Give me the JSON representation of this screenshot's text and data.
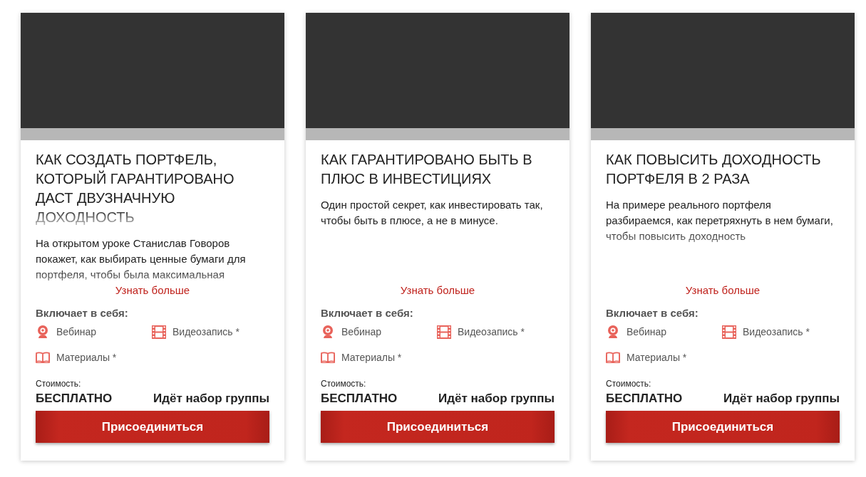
{
  "cards": [
    {
      "title": "КАК СОЗДАТЬ ПОРТФЕЛЬ, КОТОРЫЙ ГАРАНТИРОВАНО ДАСТ ДВУЗНАЧНУЮ ДОХОДНОСТЬ",
      "description": "На открытом уроке Станислав Говоров покажет, как выбирать ценные бумаги для портфеля, чтобы была максимальная",
      "link": "Узнать больше",
      "includes_label": "Включает в себя:",
      "includes": [
        {
          "kind": "webinar",
          "label": "Вебинар"
        },
        {
          "kind": "video",
          "label": "Видеозапись *"
        },
        {
          "kind": "materials",
          "label": "Материалы *"
        }
      ],
      "price_label": "Стоимость:",
      "price": "БЕСПЛАТНО",
      "status": "Идёт набор группы",
      "button": "Присоединиться"
    },
    {
      "title": "КАК ГАРАНТИРОВАНО БЫТЬ В ПЛЮС В ИНВЕСТИЦИЯХ",
      "description": "Один простой секрет, как инвестировать так, чтобы быть в плюсе, а не в минусе.",
      "link": "Узнать больше",
      "includes_label": "Включает в себя:",
      "includes": [
        {
          "kind": "webinar",
          "label": "Вебинар"
        },
        {
          "kind": "video",
          "label": "Видеозапись *"
        },
        {
          "kind": "materials",
          "label": "Материалы *"
        }
      ],
      "price_label": "Стоимость:",
      "price": "БЕСПЛАТНО",
      "status": "Идёт набор группы",
      "button": "Присоединиться"
    },
    {
      "title": "КАК ПОВЫСИТЬ ДОХОДНОСТЬ ПОРТФЕЛЯ В 2 РАЗА",
      "description": "На примере реального портфеля разбираемся, как перетряхнуть в нем бумаги, чтобы повысить доходность",
      "link": "Узнать больше",
      "includes_label": "Включает в себя:",
      "includes": [
        {
          "kind": "webinar",
          "label": "Вебинар"
        },
        {
          "kind": "video",
          "label": "Видеозапись *"
        },
        {
          "kind": "materials",
          "label": "Материалы *"
        }
      ],
      "price_label": "Стоимость:",
      "price": "БЕСПЛАТНО",
      "status": "Идёт набор группы",
      "button": "Присоединиться"
    }
  ]
}
